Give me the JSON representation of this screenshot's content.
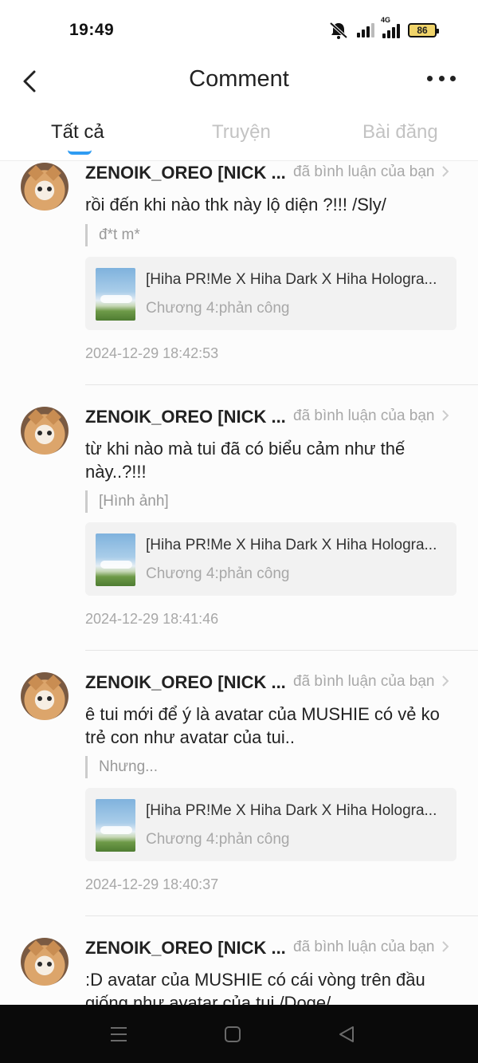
{
  "status_bar": {
    "time": "19:49",
    "network_label": "4G",
    "battery": "86",
    "icons": [
      "bell-muted-icon",
      "signal-icon",
      "signal-4g-icon",
      "battery-icon"
    ]
  },
  "header": {
    "title": "Comment",
    "back_icon": "chevron-left-icon",
    "more_icon": "more-horizontal-icon"
  },
  "tabs": [
    {
      "label": "Tất cả",
      "active": true
    },
    {
      "label": "Truyện",
      "active": false
    },
    {
      "label": "Bài đăng",
      "active": false
    }
  ],
  "colors": {
    "accent": "#2f9cf2",
    "muted_text": "#a8a8a8",
    "story_box_bg": "#f2f2f2",
    "nav_bar_bg": "#0a0a0a"
  },
  "comments": [
    {
      "username": "ZENOIK_OREO [NICK ...",
      "action": "đã bình luận của bạn",
      "text": "rồi đến khi nào thk này lộ diện ?!!! /Sly/",
      "quote": "đ*t m*",
      "story_title": "[Hiha PR!Me X Hiha Dark X Hiha Hologra...",
      "story_chapter": "Chương 4:phản công",
      "timestamp": "2024-12-29 18:42:53"
    },
    {
      "username": "ZENOIK_OREO [NICK ...",
      "action": "đã bình luận của bạn",
      "text": "từ khi nào mà tui đã có biểu cảm như thế này..?!!!",
      "quote": "[Hình ảnh]",
      "story_title": "[Hiha PR!Me X Hiha Dark X Hiha Hologra...",
      "story_chapter": "Chương 4:phản công",
      "timestamp": "2024-12-29 18:41:46"
    },
    {
      "username": "ZENOIK_OREO [NICK ...",
      "action": "đã bình luận của bạn",
      "text": "ê tui mới để ý là avatar của MUSHIE có vẻ ko trẻ con như avatar của tui..",
      "quote": "Nhưng...",
      "story_title": "[Hiha PR!Me X Hiha Dark X Hiha Hologra...",
      "story_chapter": "Chương 4:phản công",
      "timestamp": "2024-12-29 18:40:37"
    },
    {
      "username": "ZENOIK_OREO [NICK ...",
      "action": "đã bình luận của bạn",
      "text": ":D avatar của MUSHIE có cái vòng trên đầu giống như avatar của tui /Doge/"
    }
  ],
  "nav_bar": {
    "icons": [
      "menu-icon",
      "home-square-icon",
      "back-triangle-icon"
    ]
  }
}
